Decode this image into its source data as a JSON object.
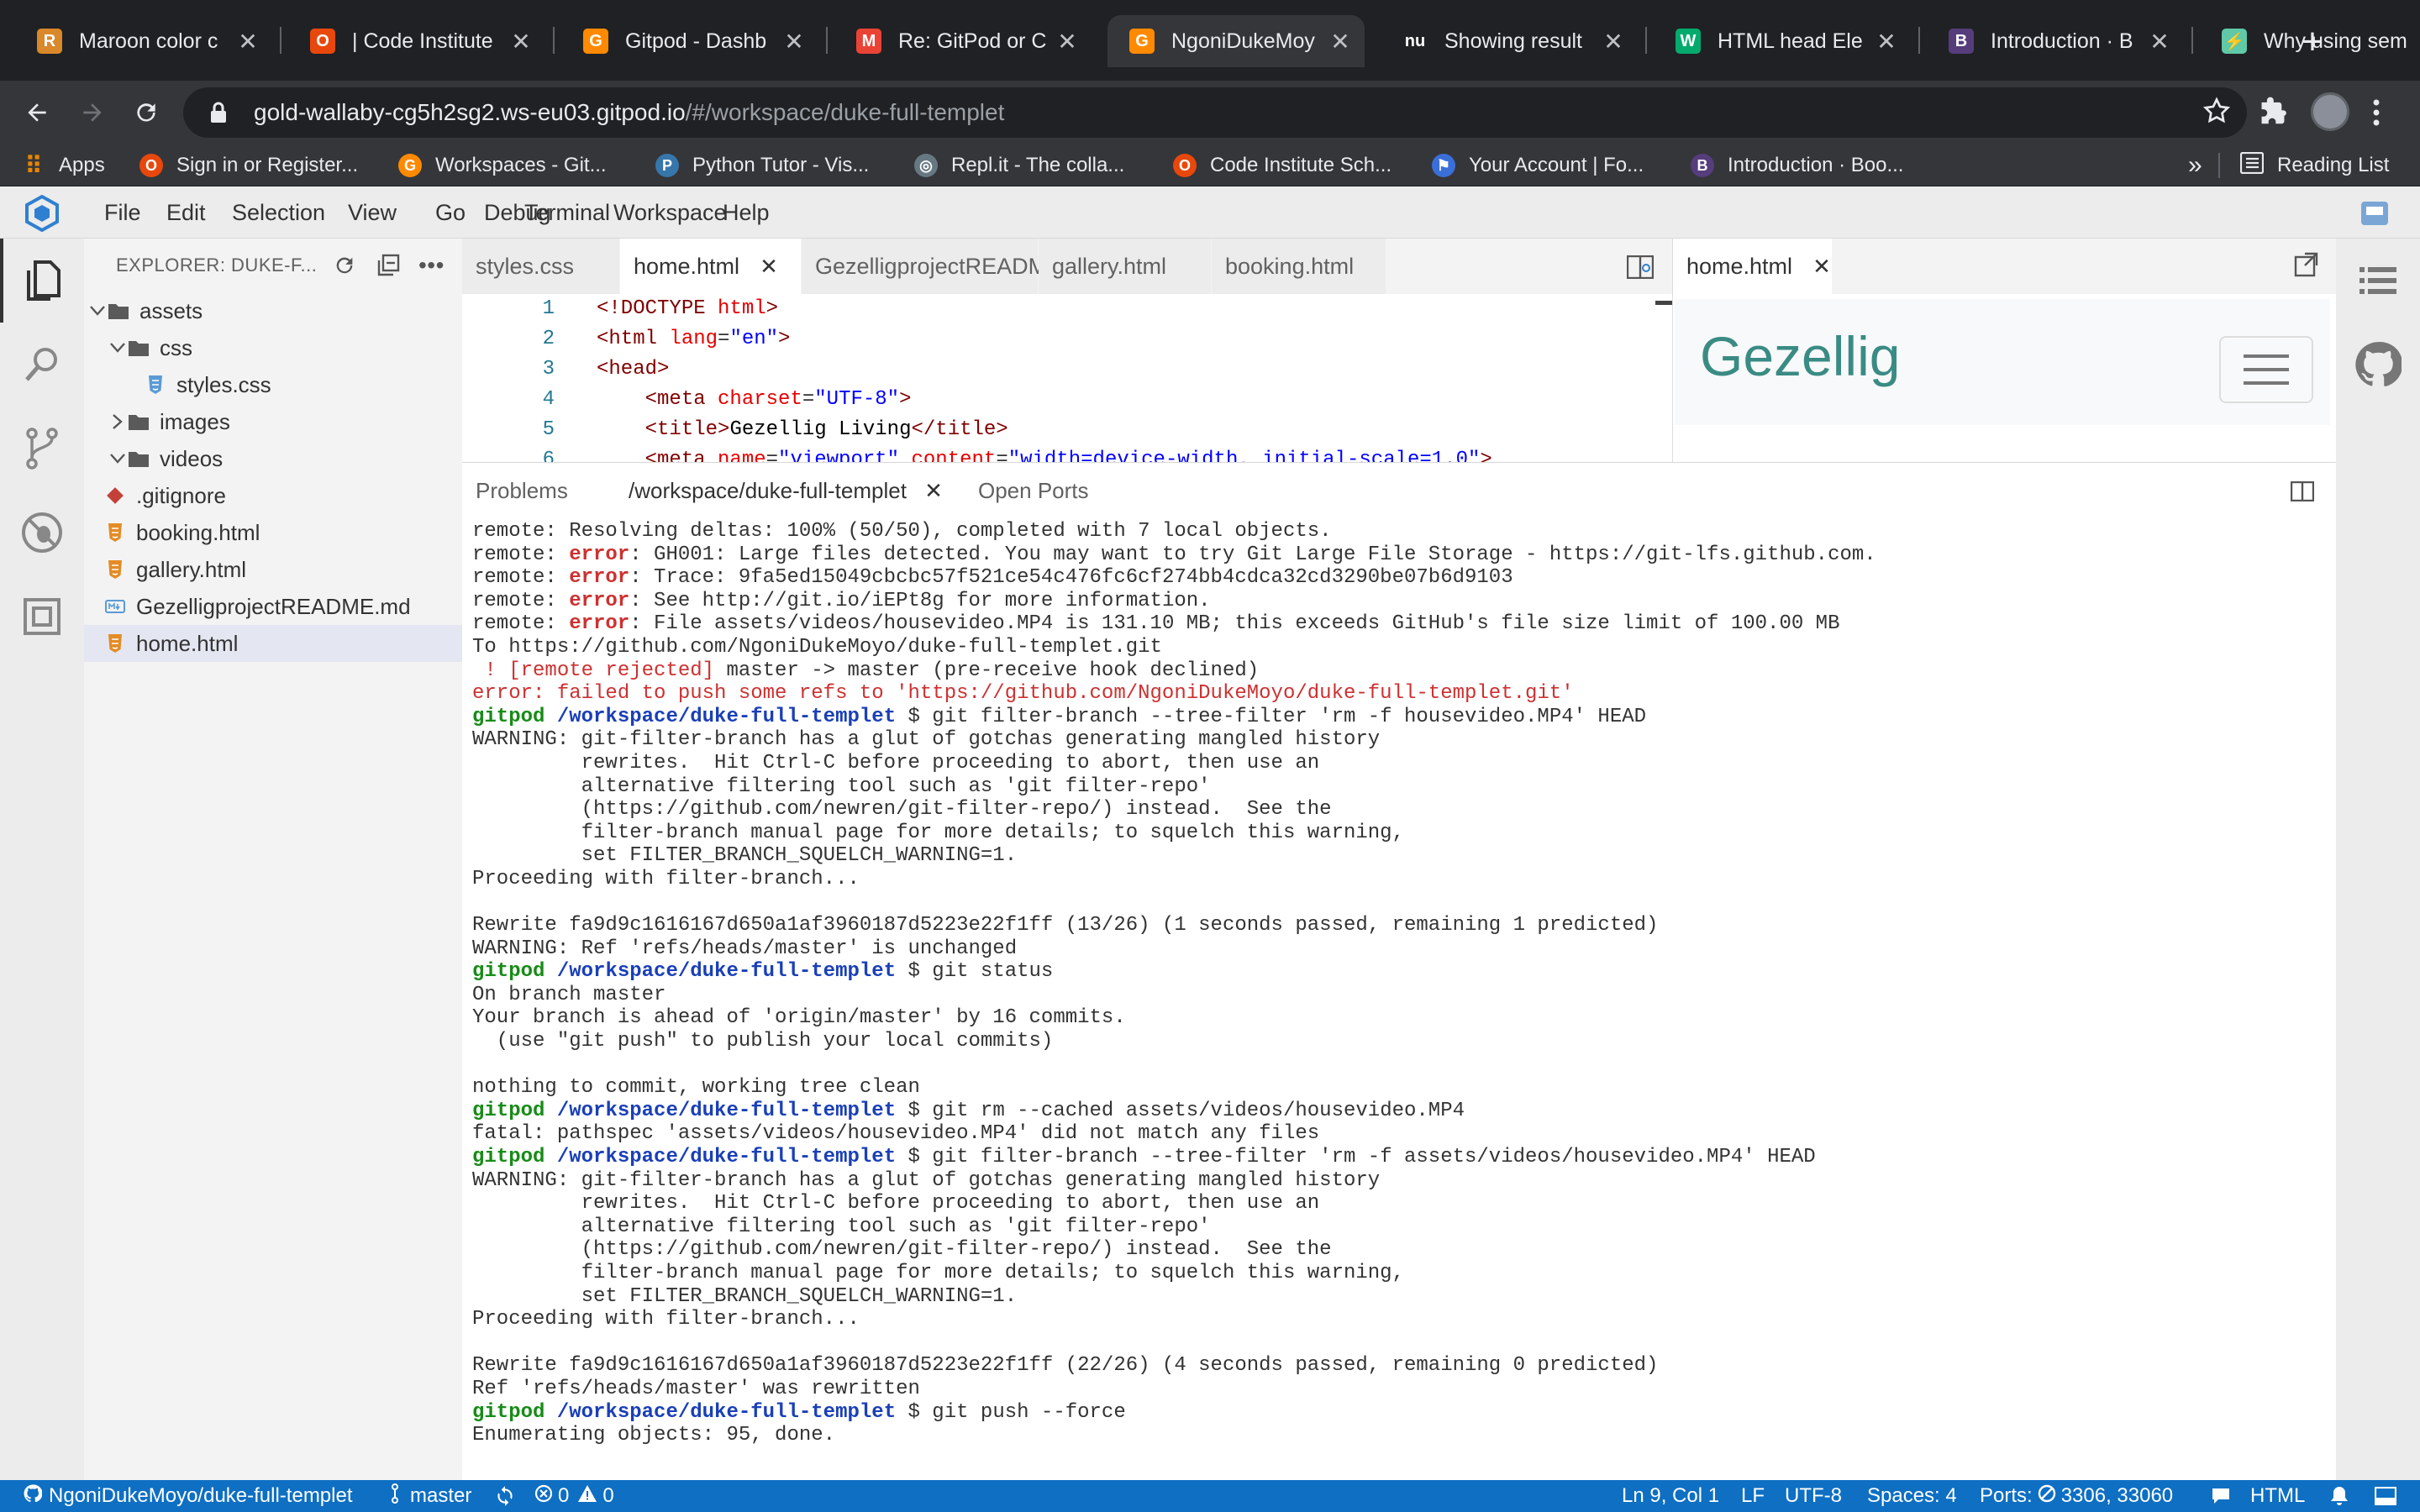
{
  "browser": {
    "tabs": [
      {
        "title": "Maroon color c",
        "favicon": "R",
        "favicon_bg": "#d9882a"
      },
      {
        "title": "| Code Institute",
        "favicon": "O",
        "favicon_bg": "#e8480c"
      },
      {
        "title": "Gitpod - Dashb",
        "favicon": "G",
        "favicon_bg": "#ff8a00"
      },
      {
        "title": "Re: GitPod or C",
        "favicon": "M",
        "favicon_bg": "#ea4335"
      },
      {
        "title": "NgoniDukeMoy",
        "favicon": "G",
        "favicon_bg": "#ff8a00"
      },
      {
        "title": "Showing result",
        "favicon": "nu",
        "favicon_bg": "#202124"
      },
      {
        "title": "HTML head Ele",
        "favicon": "W",
        "favicon_bg": "#04aa6d"
      },
      {
        "title": "Introduction · B",
        "favicon": "B",
        "favicon_bg": "#563d7c"
      },
      {
        "title": "Why using sem",
        "favicon": "⚡",
        "favicon_bg": "#5fc9a8"
      }
    ],
    "active_tab": 4,
    "url_main": "gold-wallaby-cg5h2sg2.ws-eu03.gitpod.io",
    "url_rest": "/#/workspace/duke-full-templet",
    "bookmarks": [
      {
        "label": "Apps",
        "icon_bg": "#4285f4",
        "glyph": "⋮"
      },
      {
        "label": "Sign in or Register...",
        "icon_bg": "#e8480c",
        "glyph": "O"
      },
      {
        "label": "Workspaces - Git...",
        "icon_bg": "#ff8a00",
        "glyph": "G"
      },
      {
        "label": "Python Tutor - Vis...",
        "icon_bg": "#3776ab",
        "glyph": "P"
      },
      {
        "label": "Repl.it - The colla...",
        "icon_bg": "#667881",
        "glyph": "◎"
      },
      {
        "label": "Code Institute Sch...",
        "icon_bg": "#e8480c",
        "glyph": "O"
      },
      {
        "label": "Your Account | Fo...",
        "icon_bg": "#3b6fd8",
        "glyph": "⚑"
      },
      {
        "label": "Introduction · Boo...",
        "icon_bg": "#563d7c",
        "glyph": "B"
      }
    ],
    "bookmarks_more": "»",
    "reading_list": "Reading List"
  },
  "ide": {
    "menu": [
      "File",
      "Edit",
      "Selection",
      "View",
      "Go",
      "Debug",
      "Terminal",
      "Workspace",
      "Help"
    ],
    "explorer_title": "EXPLORER: DUKE-F...",
    "tree": [
      {
        "label": "assets",
        "kind": "folder",
        "open": true,
        "depth": 0
      },
      {
        "label": "css",
        "kind": "folder",
        "open": true,
        "depth": 1
      },
      {
        "label": "styles.css",
        "kind": "css",
        "depth": 2
      },
      {
        "label": "images",
        "kind": "folder",
        "open": false,
        "depth": 1
      },
      {
        "label": "videos",
        "kind": "folder",
        "open": true,
        "depth": 1
      },
      {
        "label": ".gitignore",
        "kind": "git",
        "depth": 0
      },
      {
        "label": "booking.html",
        "kind": "html",
        "depth": 0
      },
      {
        "label": "gallery.html",
        "kind": "html",
        "depth": 0
      },
      {
        "label": "GezelligprojectREADME.md",
        "kind": "md",
        "depth": 0
      },
      {
        "label": "home.html",
        "kind": "html",
        "depth": 0,
        "selected": true
      }
    ],
    "editor_tabs": [
      {
        "label": "styles.css",
        "active": false,
        "closable": false
      },
      {
        "label": "home.html",
        "active": true,
        "closable": true
      },
      {
        "label": "GezelligprojectREADME.md",
        "active": false,
        "closable": false
      },
      {
        "label": "gallery.html",
        "active": false,
        "closable": false
      },
      {
        "label": "booking.html",
        "active": false,
        "closable": false
      }
    ],
    "code_lines": [
      {
        "n": "1",
        "html": "<span class=\"tag\">&lt;!DOCTYPE</span> <span class=\"attr\">html</span><span class=\"tag\">&gt;</span>"
      },
      {
        "n": "2",
        "html": "<span class=\"tag\">&lt;html</span> <span class=\"attr\">lang</span>=<span class=\"str\">\"en\"</span><span class=\"tag\">&gt;</span>"
      },
      {
        "n": "3",
        "html": "<span class=\"tag\">&lt;head&gt;</span>"
      },
      {
        "n": "4",
        "html": "    <span class=\"tag\">&lt;meta</span> <span class=\"attr\">charset</span>=<span class=\"str\">\"UTF-8\"</span><span class=\"tag\">&gt;</span>"
      },
      {
        "n": "5",
        "html": "    <span class=\"tag\">&lt;title&gt;</span><span class=\"txt\">Gezellig Living</span><span class=\"tag\">&lt;/title&gt;</span>"
      },
      {
        "n": "6",
        "html": "    <span class=\"tag\">&lt;meta</span> <span class=\"attr\">name</span>=<span class=\"str\">\"viewport\"</span> <span class=\"attr\">content</span>=<span class=\"str\">\"width=device-width, initial-scale=1.0\"</span><span class=\"tag\">&gt;</span>"
      }
    ],
    "preview_tab": "home.html",
    "preview_brand": "Gezellig",
    "panel_tabs": [
      {
        "label": "Problems",
        "active": false
      },
      {
        "label": "/workspace/duke-full-templet",
        "active": true
      },
      {
        "label": "Open Ports",
        "active": false
      }
    ],
    "terminal_lines": [
      [
        {
          "t": "remote: Resolving deltas: 100% (50/50), completed with 7 local objects.",
          "c": ""
        }
      ],
      [
        {
          "t": "remote: ",
          "c": ""
        },
        {
          "t": "error",
          "c": "t-redb"
        },
        {
          "t": ": GH001: Large files detected. You may want to try Git Large File Storage - https://git-lfs.github.com.",
          "c": ""
        }
      ],
      [
        {
          "t": "remote: ",
          "c": ""
        },
        {
          "t": "error",
          "c": "t-redb"
        },
        {
          "t": ": Trace: 9fa5ed15049cbcbc57f521ce54c476fc6cf274bb4cdca32cd3290be07b6d9103",
          "c": ""
        }
      ],
      [
        {
          "t": "remote: ",
          "c": ""
        },
        {
          "t": "error",
          "c": "t-redb"
        },
        {
          "t": ": See http://git.io/iEPt8g for more information.",
          "c": ""
        }
      ],
      [
        {
          "t": "remote: ",
          "c": ""
        },
        {
          "t": "error",
          "c": "t-redb"
        },
        {
          "t": ": File assets/videos/housevideo.MP4 is 131.10 MB; this exceeds GitHub's file size limit of 100.00 MB",
          "c": ""
        }
      ],
      [
        {
          "t": "To https://github.com/NgoniDukeMoyo/duke-full-templet.git",
          "c": ""
        }
      ],
      [
        {
          "t": " ! [remote rejected]",
          "c": "t-red"
        },
        {
          "t": " master -> master (pre-receive hook declined)",
          "c": ""
        }
      ],
      [
        {
          "t": "error: failed to push some refs to 'https://github.com/NgoniDukeMoyo/duke-full-templet.git'",
          "c": "t-red"
        }
      ],
      [
        {
          "t": "gitpod",
          "c": "t-green"
        },
        {
          "t": " ",
          "c": ""
        },
        {
          "t": "/workspace/duke-full-templet",
          "c": "t-blue"
        },
        {
          "t": " $ git filter-branch --tree-filter 'rm -f housevideo.MP4' HEAD",
          "c": ""
        }
      ],
      [
        {
          "t": "WARNING: git-filter-branch has a glut of gotchas generating mangled history",
          "c": ""
        }
      ],
      [
        {
          "t": "         rewrites.  Hit Ctrl-C before proceeding to abort, then use an",
          "c": ""
        }
      ],
      [
        {
          "t": "         alternative filtering tool such as 'git filter-repo'",
          "c": ""
        }
      ],
      [
        {
          "t": "         (https://github.com/newren/git-filter-repo/) instead.  See the",
          "c": ""
        }
      ],
      [
        {
          "t": "         filter-branch manual page for more details; to squelch this warning,",
          "c": ""
        }
      ],
      [
        {
          "t": "         set FILTER_BRANCH_SQUELCH_WARNING=1.",
          "c": ""
        }
      ],
      [
        {
          "t": "Proceeding with filter-branch...",
          "c": ""
        }
      ],
      [
        {
          "t": "",
          "c": ""
        }
      ],
      [
        {
          "t": "Rewrite fa9d9c1616167d650a1af3960187d5223e22f1ff (13/26) (1 seconds passed, remaining 1 predicted)",
          "c": ""
        }
      ],
      [
        {
          "t": "WARNING: Ref 'refs/heads/master' is unchanged",
          "c": ""
        }
      ],
      [
        {
          "t": "gitpod",
          "c": "t-green"
        },
        {
          "t": " ",
          "c": ""
        },
        {
          "t": "/workspace/duke-full-templet",
          "c": "t-blue"
        },
        {
          "t": " $ git status",
          "c": ""
        }
      ],
      [
        {
          "t": "On branch master",
          "c": ""
        }
      ],
      [
        {
          "t": "Your branch is ahead of 'origin/master' by 16 commits.",
          "c": ""
        }
      ],
      [
        {
          "t": "  (use \"git push\" to publish your local commits)",
          "c": ""
        }
      ],
      [
        {
          "t": "",
          "c": ""
        }
      ],
      [
        {
          "t": "nothing to commit, working tree clean",
          "c": ""
        }
      ],
      [
        {
          "t": "gitpod",
          "c": "t-green"
        },
        {
          "t": " ",
          "c": ""
        },
        {
          "t": "/workspace/duke-full-templet",
          "c": "t-blue"
        },
        {
          "t": " $ git rm --cached assets/videos/housevideo.MP4",
          "c": ""
        }
      ],
      [
        {
          "t": "fatal: pathspec 'assets/videos/housevideo.MP4' did not match any files",
          "c": ""
        }
      ],
      [
        {
          "t": "gitpod",
          "c": "t-green"
        },
        {
          "t": " ",
          "c": ""
        },
        {
          "t": "/workspace/duke-full-templet",
          "c": "t-blue"
        },
        {
          "t": " $ git filter-branch --tree-filter 'rm -f assets/videos/housevideo.MP4' HEAD",
          "c": ""
        }
      ],
      [
        {
          "t": "WARNING: git-filter-branch has a glut of gotchas generating mangled history",
          "c": ""
        }
      ],
      [
        {
          "t": "         rewrites.  Hit Ctrl-C before proceeding to abort, then use an",
          "c": ""
        }
      ],
      [
        {
          "t": "         alternative filtering tool such as 'git filter-repo'",
          "c": ""
        }
      ],
      [
        {
          "t": "         (https://github.com/newren/git-filter-repo/) instead.  See the",
          "c": ""
        }
      ],
      [
        {
          "t": "         filter-branch manual page for more details; to squelch this warning,",
          "c": ""
        }
      ],
      [
        {
          "t": "         set FILTER_BRANCH_SQUELCH_WARNING=1.",
          "c": ""
        }
      ],
      [
        {
          "t": "Proceeding with filter-branch...",
          "c": ""
        }
      ],
      [
        {
          "t": "",
          "c": ""
        }
      ],
      [
        {
          "t": "Rewrite fa9d9c1616167d650a1af3960187d5223e22f1ff (22/26) (4 seconds passed, remaining 0 predicted)",
          "c": ""
        }
      ],
      [
        {
          "t": "Ref 'refs/heads/master' was rewritten",
          "c": ""
        }
      ],
      [
        {
          "t": "gitpod",
          "c": "t-green"
        },
        {
          "t": " ",
          "c": ""
        },
        {
          "t": "/workspace/duke-full-templet",
          "c": "t-blue"
        },
        {
          "t": " $ git push --force",
          "c": ""
        }
      ],
      [
        {
          "t": "Enumerating objects: 95, done.",
          "c": ""
        }
      ]
    ]
  },
  "status": {
    "repo": "NgoniDukeMoyo/duke-full-templet",
    "branch": "master",
    "errors": "0",
    "warnings": "0",
    "cursor": "Ln 9, Col 1",
    "eol": "LF",
    "encoding": "UTF-8",
    "indent": "Spaces: 4",
    "ports_label": "Ports:",
    "ports": "3306, 33060",
    "language": "HTML"
  },
  "colors": {
    "status_bar": "#0e6fc3",
    "prompt_user": "#178c17",
    "prompt_path": "#1a3fb8",
    "error": "#cd3131",
    "brand": "#3a8b84"
  }
}
